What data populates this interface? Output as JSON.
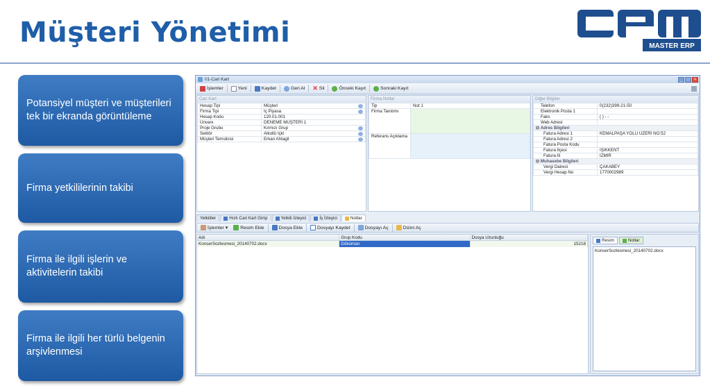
{
  "slide": {
    "title": "Müşteri Yönetimi",
    "logo": {
      "letters": "CRM",
      "tagline": "MASTER ERP",
      "color": "#1f4e8f"
    }
  },
  "features": [
    "Potansiyel müşteri ve müşterileri tek bir ekranda görüntüleme",
    "Firma yetkililerinin takibi",
    "Firma ile ilgili işlerin ve aktivitelerin takibi",
    "Firma ile ilgili her türlü belgenin arşivlenmesi"
  ],
  "window": {
    "title": "01-Cari Kart",
    "toolbar": [
      "İşlemler",
      "Yeni",
      "Kaydet",
      "Geri Al",
      "Sil",
      "Önceki Kayıt",
      "Sonraki Kayıt"
    ],
    "cari": {
      "header": "Cari Kart",
      "rows": [
        {
          "label": "Hesap Tipi",
          "value": "Müşteri"
        },
        {
          "label": "Firma Tipi",
          "value": "İç Piyasa"
        },
        {
          "label": "Hesap Kodu",
          "value": "120.01.001"
        },
        {
          "label": "Ünvanı",
          "value": "DENEME MÜŞTERİ 1"
        },
        {
          "label": "Proje Grubu",
          "value": "Kırmızı Grup"
        },
        {
          "label": "Sektör",
          "value": "Alkollü İçki"
        },
        {
          "label": "Müşteri Temsilcisi",
          "value": "Erkan Ahtagil"
        }
      ]
    },
    "notes": {
      "header": "Firma Notlar",
      "rows": [
        {
          "label": "Tip",
          "value": "Not 1"
        },
        {
          "label": "Firma Tanıtımı",
          "value": ""
        },
        {
          "label": "Referans Açıklama",
          "value": ""
        }
      ]
    },
    "other": {
      "header": "Diğer Bilgiler",
      "rows": [
        {
          "label": "Telefon",
          "value": "0(232)399-21-50"
        },
        {
          "label": "Elektronik Posta 1",
          "value": ""
        },
        {
          "label": "Faks",
          "value": "( ) - -"
        },
        {
          "label": "Web Adresi",
          "value": ""
        }
      ],
      "address_header": "Adres Bilgileri",
      "address": [
        {
          "label": "Fatura Adresi 1",
          "value": "KEMALPAŞA YOLU ÜZERİ NO:52"
        },
        {
          "label": "Fatura Adresi 2",
          "value": ""
        },
        {
          "label": "Fatura Posta Kodu",
          "value": ""
        },
        {
          "label": "Fatura İlçesi",
          "value": "IŞIKKENT"
        },
        {
          "label": "Fatura İli",
          "value": "İZMİR"
        }
      ],
      "accounting_header": "Muhasebe Bilgileri",
      "accounting": [
        {
          "label": "Vergi Dairesi",
          "value": "ÇAKABEY"
        },
        {
          "label": "Vergi Hesap No",
          "value": "1770002989"
        }
      ]
    },
    "tabs": [
      "Yetkililer",
      "Hızlı Cari Kart Girişi",
      "Yetkili İzleyici",
      "İş İzleyici",
      "Notlar"
    ],
    "subtoolbar": [
      "İşlemler",
      "Resim Ekle",
      "Dosya Ekle",
      "Dosyayı Kaydet",
      "Dosyayı Aç",
      "Dizini Aç"
    ],
    "files": {
      "columns": [
        "Adı",
        "Grup Kodu",
        "Dosya Uzunluğu"
      ],
      "rows": [
        {
          "name": "KonserSozlesmesi_20140702.docx",
          "group": "Döküman",
          "size": "15218"
        }
      ]
    },
    "side": {
      "tabs": [
        "Resim",
        "Notlar"
      ],
      "content": "KonserSozlesmesi_20140702.docx"
    }
  }
}
